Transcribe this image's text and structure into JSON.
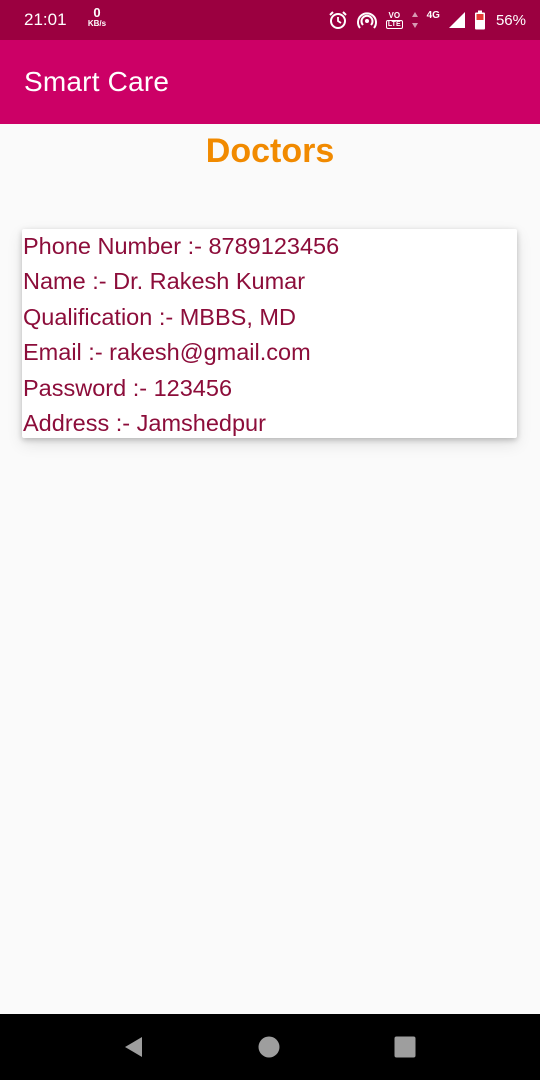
{
  "status_bar": {
    "time": "21:01",
    "net_speed_value": "0",
    "net_speed_unit": "KB/s",
    "vo_label": "VO",
    "lte_label": "LTE",
    "network_type": "4G",
    "battery_percent": "56%",
    "icons": [
      "alarm-icon",
      "hotspot-icon",
      "volte-icon",
      "data-arrows-icon",
      "signal-icon",
      "battery-icon"
    ]
  },
  "app_bar": {
    "title": "Smart Care"
  },
  "page": {
    "heading": "Doctors"
  },
  "doctor": {
    "phone": "Phone Number :- 8789123456",
    "name": "Name :- Dr. Rakesh Kumar",
    "qualification": "Qualification :- MBBS, MD",
    "email": "Email :- rakesh@gmail.com",
    "password": "Password :- 123456",
    "address": "Address :- Jamshedpur"
  },
  "nav_bar": {
    "icons": [
      "back-icon",
      "home-icon",
      "recents-icon"
    ]
  },
  "colors": {
    "status_bar": "#9b0040",
    "app_bar": "#cc0066",
    "heading": "#f18a00",
    "card_text": "#8c0d3a",
    "background": "#fafafa"
  }
}
